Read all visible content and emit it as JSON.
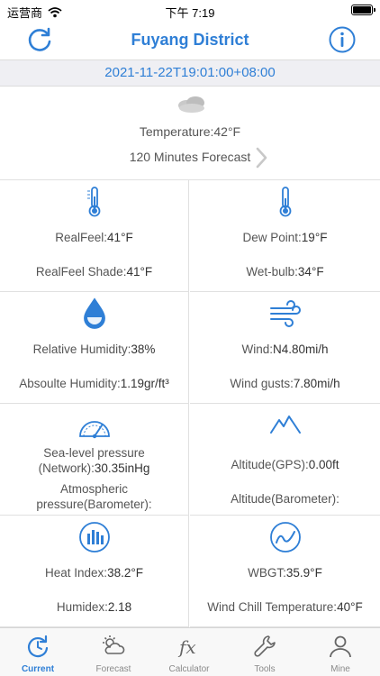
{
  "status_bar": {
    "carrier": "运营商",
    "time": "下午 7:19"
  },
  "header": {
    "title": "Fuyang District"
  },
  "timestamp": "2021-11-22T19:01:00+08:00",
  "summary": {
    "temperature_label": "Temperature:",
    "temperature_value": "42°F",
    "forecast_label": "120 Minutes Forecast"
  },
  "cells": {
    "realfeel": {
      "label": "RealFeel:",
      "value": "41°F"
    },
    "realfeel_shade": {
      "label": "RealFeel Shade:",
      "value": "41°F"
    },
    "dew_point": {
      "label": "Dew Point:",
      "value": "19°F"
    },
    "wet_bulb": {
      "label": "Wet-bulb:",
      "value": "34°F"
    },
    "rel_humidity": {
      "label": "Relative Humidity:",
      "value": "38%"
    },
    "abs_humidity": {
      "label": "Absoulte Humidity:",
      "value": "1.19gr/ft³"
    },
    "wind": {
      "label": "Wind:",
      "value": "N4.80mi/h"
    },
    "wind_gusts": {
      "label": "Wind gusts:",
      "value": "7.80mi/h"
    },
    "sea_pressure": {
      "label_a": "Sea-level pressure",
      "label_b": "(Network):",
      "value": "30.35inHg"
    },
    "atm_pressure": {
      "label_a": "Atmospheric",
      "label_b": "pressure(Barometer):"
    },
    "altitude_gps": {
      "label": "Altitude(GPS):",
      "value": "0.00ft"
    },
    "altitude_baro": {
      "label": "Altitude(Barometer):"
    },
    "heat_index": {
      "label": "Heat Index:",
      "value": "38.2°F"
    },
    "humidex": {
      "label": "Humidex:",
      "value": "2.18"
    },
    "wbgt": {
      "label": "WBGT:",
      "value": "35.9°F"
    },
    "wind_chill": {
      "label": "Wind Chill Temperature:",
      "value": "40°F"
    }
  },
  "tabs": [
    {
      "label": "Current",
      "icon": "refresh-clock-icon",
      "active": true
    },
    {
      "label": "Forecast",
      "icon": "cloud-sun-icon"
    },
    {
      "label": "Calculator",
      "icon": "fx-icon"
    },
    {
      "label": "Tools",
      "icon": "wrench-icon"
    },
    {
      "label": "Mine",
      "icon": "person-icon"
    }
  ],
  "colors": {
    "accent": "#2f7fd6",
    "divider": "#e0e0e0",
    "strip": "#efeff3"
  }
}
